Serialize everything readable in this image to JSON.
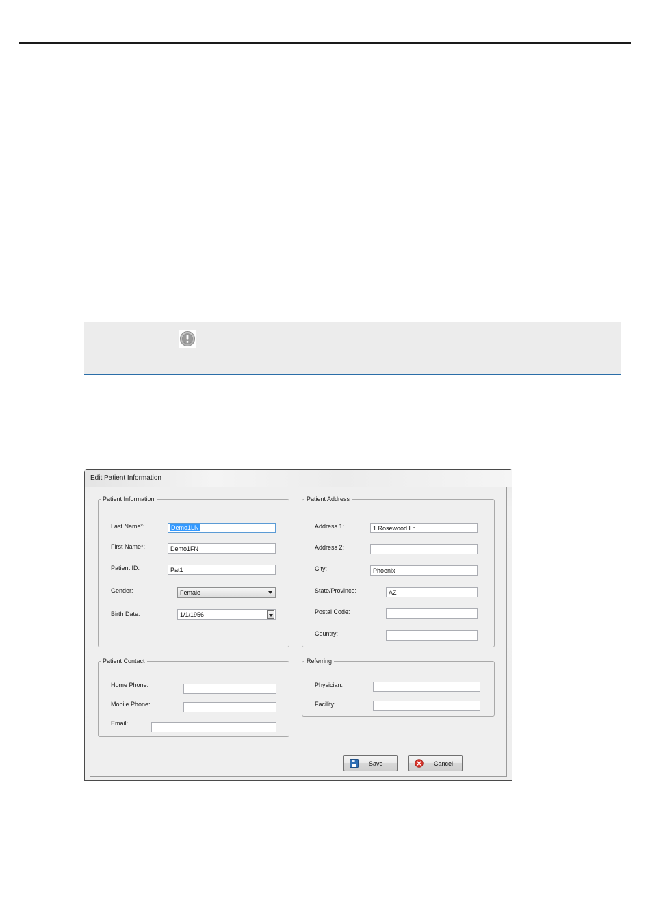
{
  "dialog": {
    "title": "Edit Patient Information",
    "groups": {
      "patient_information": "Patient Information",
      "patient_address": "Patient Address",
      "patient_contact": "Patient Contact",
      "referring": "Referring"
    },
    "patient_information": {
      "last_name_label": "Last Name*:",
      "last_name_value": "Demo1LN",
      "first_name_label": "First Name*:",
      "first_name_value": "Demo1FN",
      "patient_id_label": "Patient ID:",
      "patient_id_value": "Pat1",
      "gender_label": "Gender:",
      "gender_value": "Female",
      "birth_date_label": "Birth Date:",
      "birth_date_value": "1/1/1956"
    },
    "patient_address": {
      "address1_label": "Address 1:",
      "address1_value": "1 Rosewood Ln",
      "address2_label": "Address 2:",
      "address2_value": "",
      "city_label": "City:",
      "city_value": "Phoenix",
      "state_label": "State/Province:",
      "state_value": "AZ",
      "postal_label": "Postal Code:",
      "postal_value": "",
      "country_label": "Country:",
      "country_value": ""
    },
    "patient_contact": {
      "home_phone_label": "Home Phone:",
      "home_phone_value": "",
      "mobile_phone_label": "Mobile Phone:",
      "mobile_phone_value": "",
      "email_label": "Email:",
      "email_value": ""
    },
    "referring": {
      "physician_label": "Physician:",
      "physician_value": "",
      "facility_label": "Facility:",
      "facility_value": ""
    },
    "buttons": {
      "save_label": "Save",
      "save_icon": "floppy-disk-icon",
      "cancel_label": "Cancel",
      "cancel_icon": "cancel-circle-icon"
    }
  },
  "note": {
    "icon": "exclamation-circle-icon"
  },
  "colors": {
    "note_border": "#2b6ea8",
    "note_background": "#ececec",
    "selection": "#3399ff",
    "cancel_icon": "#d9342b",
    "save_icon": "#2f6fb5"
  }
}
